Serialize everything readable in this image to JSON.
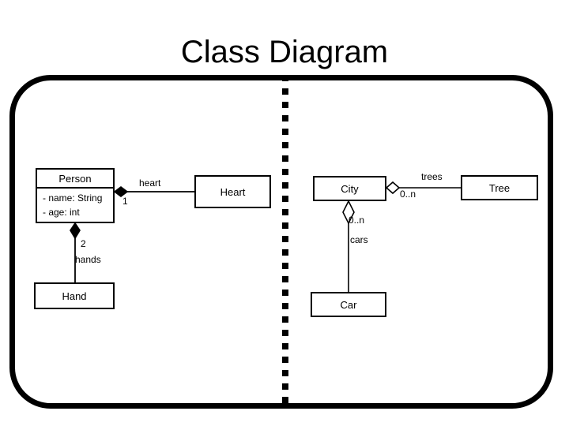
{
  "slide": {
    "title": "Class Diagram"
  },
  "frame": {
    "border_color": "#000000",
    "divider_color": "#000000"
  },
  "diagram": {
    "left_example": {
      "classes": [
        {
          "id": "person",
          "name": "Person",
          "attributes": [
            "- name: String",
            "- age: int"
          ]
        },
        {
          "id": "heart",
          "name": "Heart",
          "attributes": []
        },
        {
          "id": "hand",
          "name": "Hand",
          "attributes": []
        }
      ],
      "relations": [
        {
          "from": "person",
          "to": "heart",
          "kind": "composition",
          "diamond": "filled",
          "role": "heart",
          "multiplicity": "1"
        },
        {
          "from": "person",
          "to": "hand",
          "kind": "composition",
          "diamond": "filled",
          "role": "hands",
          "multiplicity": "2"
        }
      ]
    },
    "right_example": {
      "classes": [
        {
          "id": "city",
          "name": "City",
          "attributes": []
        },
        {
          "id": "tree",
          "name": "Tree",
          "attributes": []
        },
        {
          "id": "car",
          "name": "Car",
          "attributes": []
        }
      ],
      "relations": [
        {
          "from": "city",
          "to": "tree",
          "kind": "aggregation",
          "diamond": "hollow",
          "role": "trees",
          "multiplicity": "0..n"
        },
        {
          "from": "city",
          "to": "car",
          "kind": "aggregation",
          "diamond": "hollow",
          "role": "cars",
          "multiplicity": "0..n"
        }
      ]
    }
  }
}
